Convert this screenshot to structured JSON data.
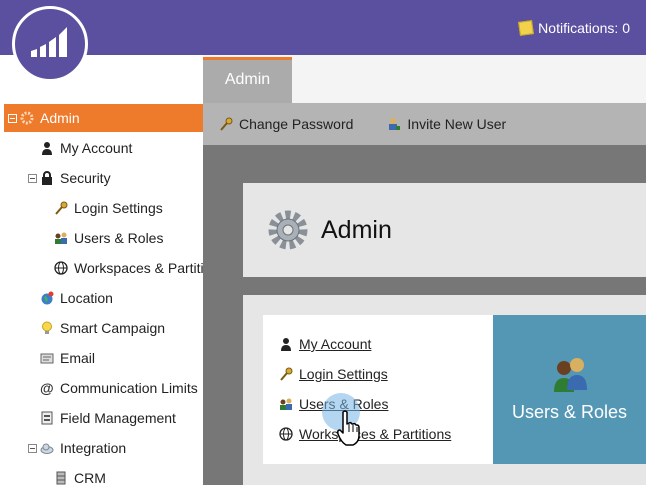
{
  "header": {
    "notifications_label": "Notifications: 0"
  },
  "sidebar": {
    "items": [
      {
        "label": "Admin",
        "icon": "gear-icon",
        "active": true
      },
      {
        "label": "My Account",
        "icon": "person-icon"
      },
      {
        "label": "Security",
        "icon": "lock-icon"
      },
      {
        "label": "Login Settings",
        "icon": "key-icon"
      },
      {
        "label": "Users & Roles",
        "icon": "users-icon"
      },
      {
        "label": "Workspaces & Partitions",
        "icon": "globe-icon"
      },
      {
        "label": "Location",
        "icon": "globe-pin-icon"
      },
      {
        "label": "Smart Campaign",
        "icon": "lightbulb-icon"
      },
      {
        "label": "Email",
        "icon": "email-icon"
      },
      {
        "label": "Communication Limits",
        "icon": "at-icon"
      },
      {
        "label": "Field Management",
        "icon": "field-icon"
      },
      {
        "label": "Integration",
        "icon": "cloud-icon"
      },
      {
        "label": "CRM",
        "icon": "database-icon"
      }
    ]
  },
  "main": {
    "tab_label": "Admin",
    "toolbar": {
      "change_password": "Change Password",
      "invite_user": "Invite New User"
    },
    "page_title": "Admin",
    "links": [
      "My Account",
      "Login Settings",
      "Users & Roles",
      "Workspaces & Partitions"
    ],
    "tile_label": "Users & Roles"
  },
  "colors": {
    "header": "#5b4fa0",
    "active": "#ee7a2b",
    "tile": "#5497b5"
  }
}
